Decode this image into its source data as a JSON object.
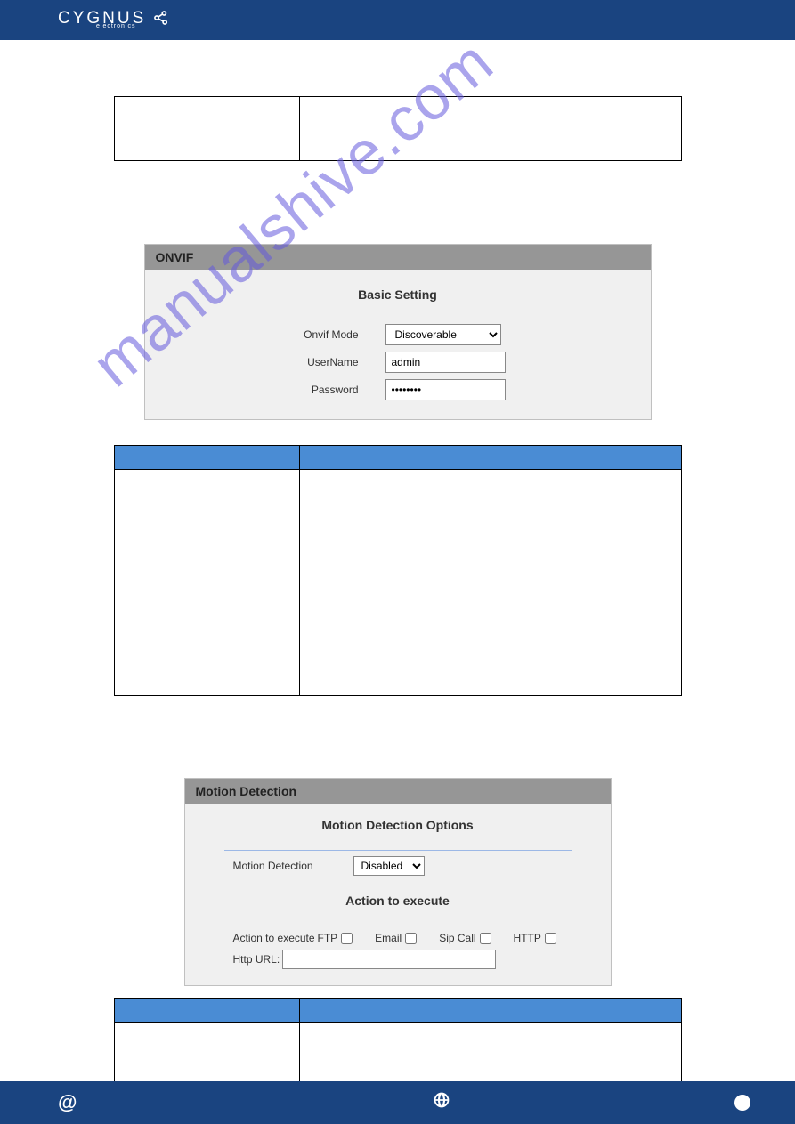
{
  "header": {
    "logo_main": "CYGNUS",
    "logo_sub": "electronics"
  },
  "onvif": {
    "panel_title": "ONVIF",
    "section_title": "Basic Setting",
    "mode_label": "Onvif Mode",
    "mode_value": "Discoverable",
    "user_label": "UserName",
    "user_value": "admin",
    "pass_label": "Password",
    "pass_value": "••••••••"
  },
  "motion": {
    "panel_title": "Motion Detection",
    "section_title": "Motion Detection Options",
    "detection_label": "Motion Detection",
    "detection_value": "Disabled",
    "action_title": "Action to execute",
    "action_label": "Action to execute",
    "options": {
      "ftp": "FTP",
      "email": "Email",
      "sip": "Sip Call",
      "http": "HTTP"
    },
    "http_url_label": "Http URL:",
    "http_url_value": ""
  },
  "watermark": "manualshive.com",
  "footer": {
    "at": "@",
    "globe": "🌐"
  }
}
